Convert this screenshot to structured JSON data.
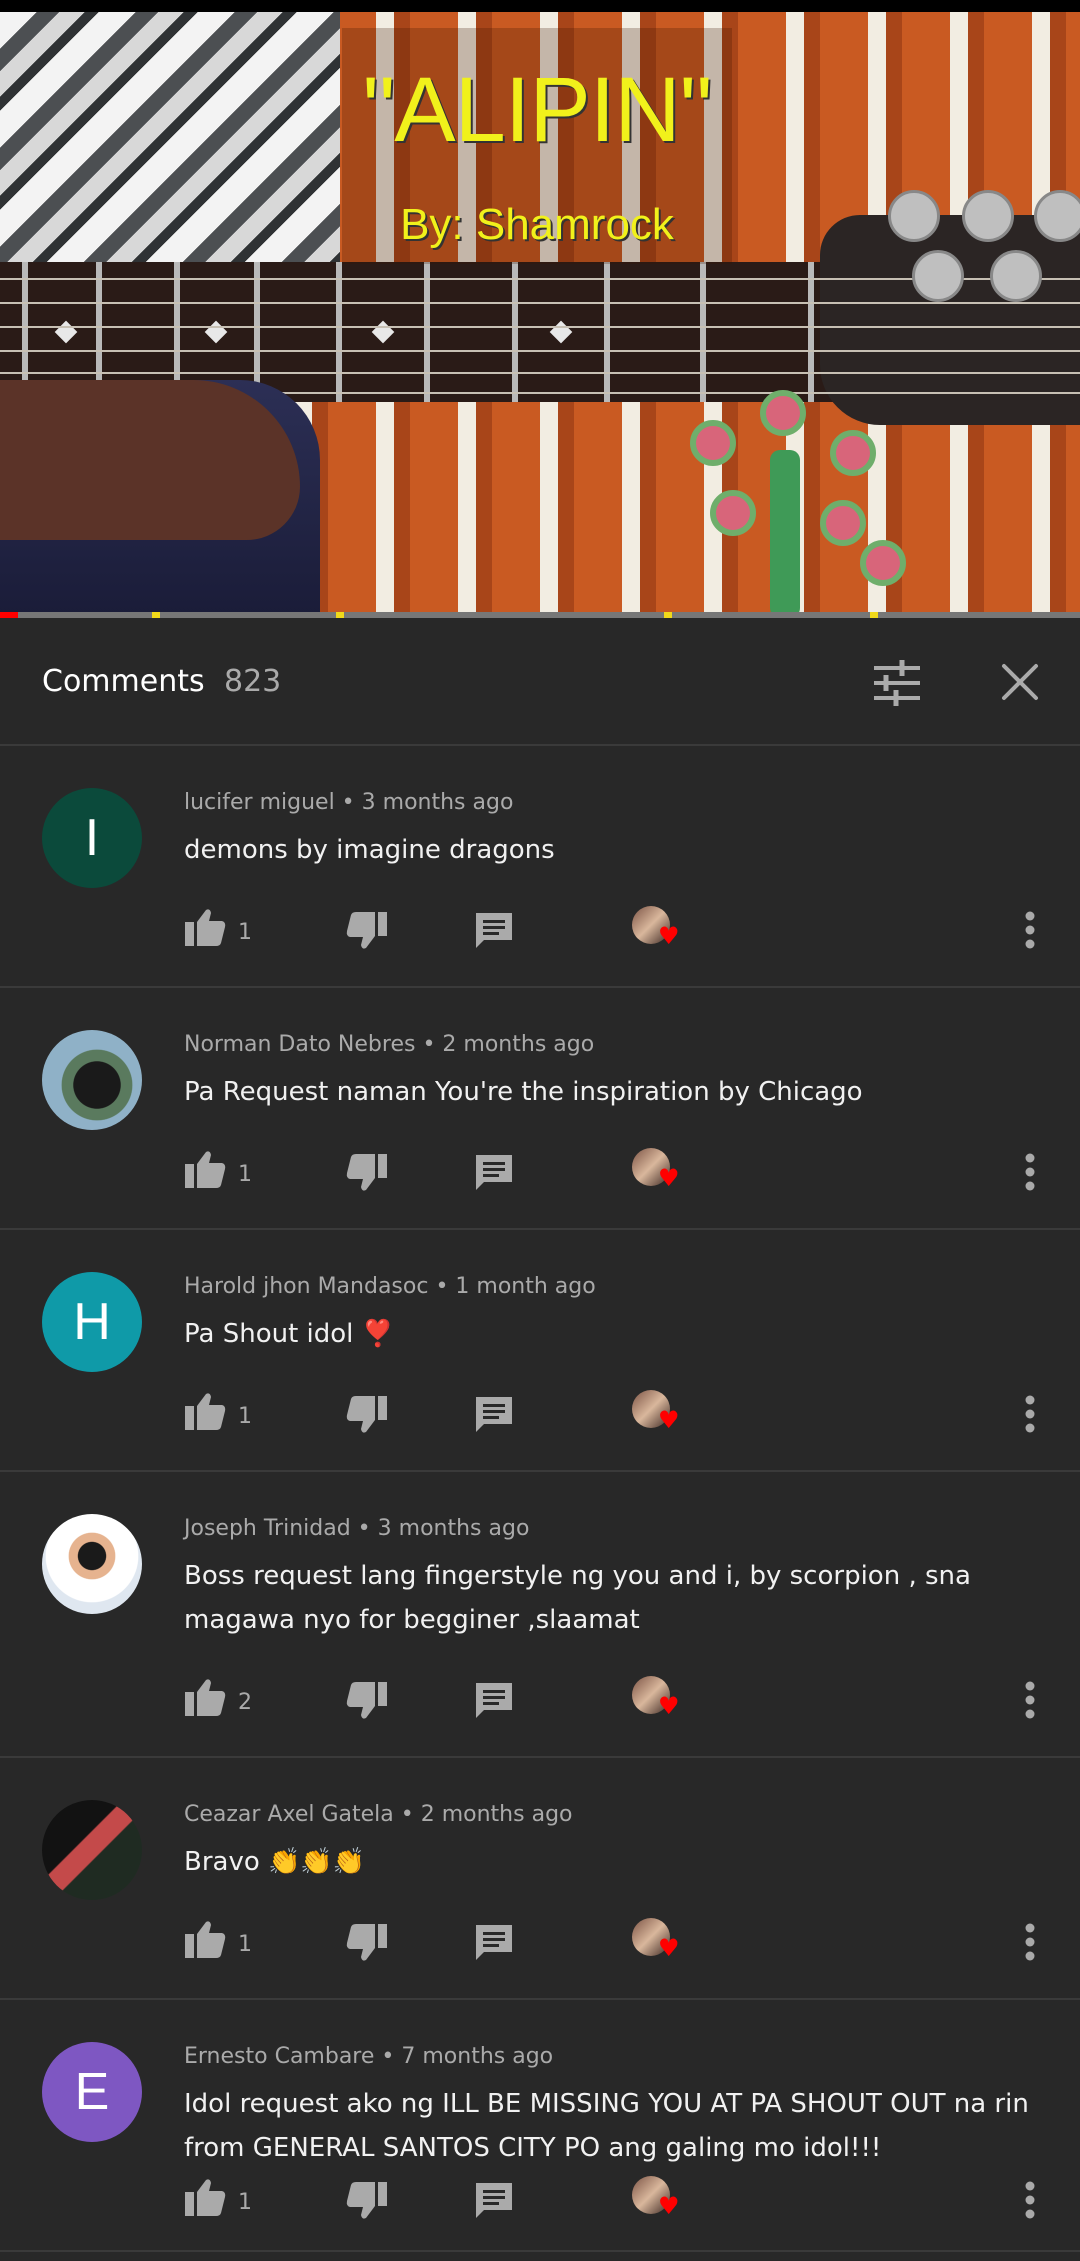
{
  "video": {
    "title": "\"ALIPIN\"",
    "subtitle": "By: Shamrock",
    "progress_fraction": 0.017
  },
  "comments_panel": {
    "title": "Comments",
    "count": "823",
    "sort_icon": "tune-icon",
    "close_icon": "close-icon"
  },
  "colors": {
    "background": "#282828",
    "accent_red": "#ff0000",
    "title_yellow": "#f1f11b"
  },
  "comments": [
    {
      "author": "lucifer miguel",
      "time": "3 months ago",
      "text": "demons by imagine dragons",
      "likes": "1",
      "avatar_letter": "I",
      "avatar_color": "#0b4a3b"
    },
    {
      "author": "Norman Dato Nebres",
      "time": "2 months ago",
      "text": "Pa Request naman You're the inspiration by Chicago",
      "likes": "1",
      "avatar_letter": "",
      "avatar_color": "#3b3f44"
    },
    {
      "author": "Harold jhon Mandasoc",
      "time": "1 month ago",
      "text": "Pa Shout idol ❣️",
      "likes": "1",
      "avatar_letter": "H",
      "avatar_color": "#0f9aa8"
    },
    {
      "author": "Joseph Trinidad",
      "time": "3 months ago",
      "text": "Boss request lang fingerstyle ng you and i, by scorpion , sna magawa nyo for begginer ,slaamat",
      "likes": "2",
      "avatar_letter": "",
      "avatar_color": "#f4f4f4"
    },
    {
      "author": "Ceazar Axel Gatela",
      "time": "2 months ago",
      "text": "Bravo 👏👏👏",
      "likes": "1",
      "avatar_letter": "",
      "avatar_color": "#1e1e1e"
    },
    {
      "author": "Ernesto Cambare",
      "time": "7 months ago",
      "text": "Idol request ako ng ILL BE MISSING YOU AT PA SHOUT OUT na rin from GENERAL SANTOS CITY PO ang galing mo idol!!!",
      "likes": "1",
      "avatar_letter": "E",
      "avatar_color": "#7e57c2"
    }
  ]
}
